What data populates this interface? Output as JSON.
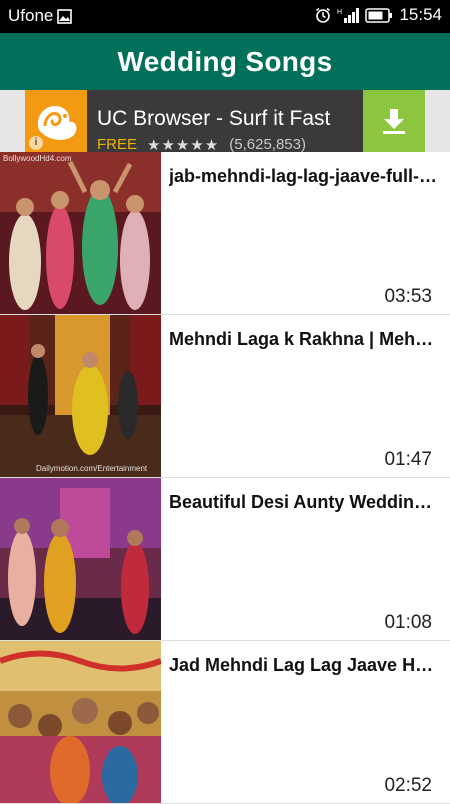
{
  "status_bar": {
    "carrier": "Ufone",
    "time": "15:54",
    "icons": [
      "image-icon",
      "alarm-icon",
      "signal-icon",
      "battery-icon"
    ]
  },
  "app_bar": {
    "title": "Wedding Songs"
  },
  "ad": {
    "title": "UC Browser - Surf it Fast",
    "price": "FREE",
    "rating_stars": 4.5,
    "rating_count": "(5,625,853)",
    "icons": [
      "uc-squirrel-logo",
      "info-icon",
      "download-icon"
    ],
    "colors": {
      "logo": "#f39a12",
      "download": "#8cc63f",
      "price": "#f0b400"
    }
  },
  "videos": [
    {
      "title": "jab-mehndi-lag-lag-jaave-full-song",
      "duration": "03:53",
      "watermark": "BollywoodHd4.com"
    },
    {
      "title": "Mehndi Laga k Rakhna | Mehndi Songs",
      "duration": "01:47",
      "watermark": "Dailymotion.com/Entertainment"
    },
    {
      "title": "Beautiful Desi Aunty Wedding Dance",
      "duration": "01:08",
      "watermark": ""
    },
    {
      "title": "Jad Mehndi Lag Lag Jaave Hd Song",
      "duration": "02:52",
      "watermark": ""
    }
  ],
  "colors": {
    "app_bar": "#00705b",
    "status_bar": "#000000"
  }
}
